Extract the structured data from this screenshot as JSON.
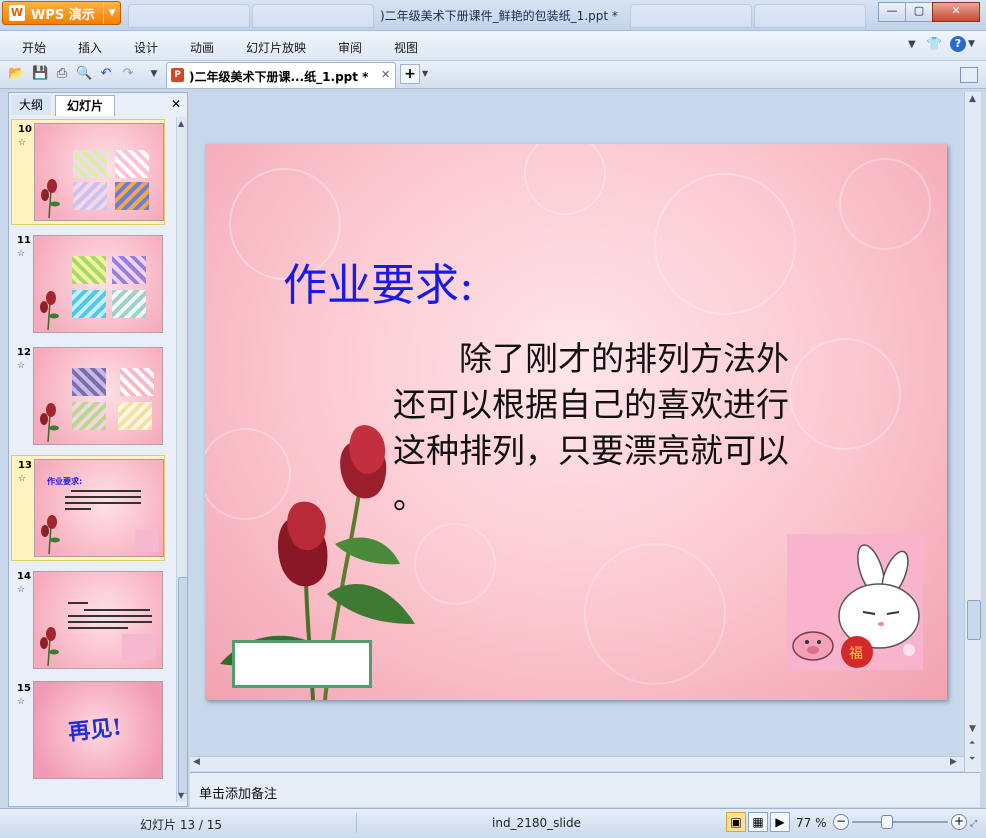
{
  "app": {
    "name": "WPS 演示",
    "logo_glyph": "W",
    "window_title": ")二年级美术下册课件_鲜艳的包装纸_1.ppt *",
    "window_buttons": {
      "minimize": "—",
      "maximize": "▢",
      "close": "✕"
    }
  },
  "menu": {
    "items": [
      "开始",
      "插入",
      "设计",
      "动画",
      "幻灯片放映",
      "审阅",
      "视图"
    ]
  },
  "toolbar": {
    "doc_tab_label": ")二年级美术下册课...纸_1.ppt *",
    "doc_tab_close": "✕",
    "new_tab": "+",
    "icons": [
      "open-icon",
      "save-icon",
      "print-icon",
      "print-preview-icon",
      "undo-icon",
      "redo-icon"
    ]
  },
  "left_panel": {
    "tabs": [
      "大纲",
      "幻灯片"
    ],
    "close": "✕",
    "thumbnails": [
      {
        "number": "10",
        "star": "☆"
      },
      {
        "number": "11",
        "star": "☆"
      },
      {
        "number": "12",
        "star": "☆"
      },
      {
        "number": "13",
        "star": "☆",
        "title": "作业要求:"
      },
      {
        "number": "14",
        "star": "☆"
      },
      {
        "number": "15",
        "star": "☆",
        "text": "再见!"
      }
    ],
    "selected": "13"
  },
  "slide": {
    "title": "作业要求:",
    "body": "　　除了刚才的排列方法外还可以根据自己的喜欢进行这种排列，只要漂亮就可以 。"
  },
  "notes": {
    "placeholder": "单击添加备注"
  },
  "status": {
    "slide_counter": "幻灯片 13 / 15",
    "theme": "ind_2180_slide",
    "zoom": "77 %",
    "zoom_minus": "−",
    "zoom_plus": "+"
  },
  "colors": {
    "title_blue": "#1a1ae8",
    "wps_orange": "#f07e00",
    "slide_pink": "#f6aabb",
    "selected_thumb": "#fff4bf"
  }
}
